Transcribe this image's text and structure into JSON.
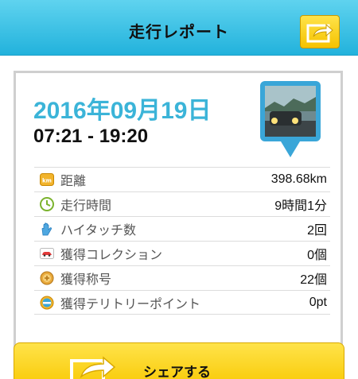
{
  "header": {
    "title": "走行レポート"
  },
  "report": {
    "date": "2016年09月19日",
    "time_range": "07:21 - 19:20"
  },
  "stats": [
    {
      "icon": "km-icon",
      "label": "距離",
      "value": "398.68km"
    },
    {
      "icon": "clock-icon",
      "label": "走行時間",
      "value": "9時間1分"
    },
    {
      "icon": "hand-icon",
      "label": "ハイタッチ数",
      "value": "2回"
    },
    {
      "icon": "car-icon",
      "label": "獲得コレクション",
      "value": "0個"
    },
    {
      "icon": "medal-icon",
      "label": "獲得称号",
      "value": "22個"
    },
    {
      "icon": "territory-icon",
      "label": "獲得テリトリーポイント",
      "value": "0pt"
    }
  ],
  "share_button": {
    "label": "シェアする"
  },
  "colors": {
    "header": "#22b2dc",
    "accent_date": "#3bb4d8",
    "button_yellow": "#f8c800"
  }
}
